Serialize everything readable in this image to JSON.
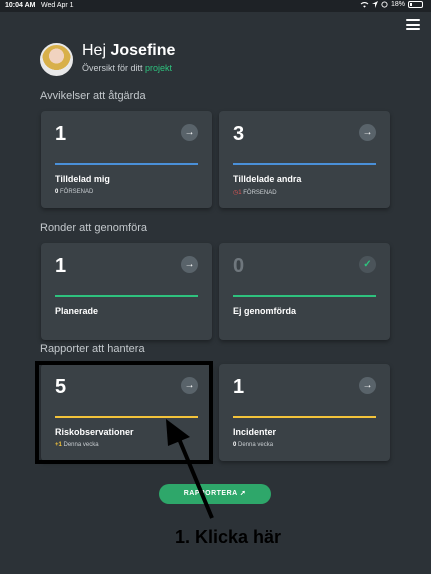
{
  "status_bar": {
    "time": "10:04 AM",
    "date": "Wed Apr 1",
    "battery": "18%",
    "battery_level": 0.18
  },
  "header": {
    "greeting_prefix": "Hej",
    "user_name": "Josefine",
    "overview_prefix": "Översikt för ditt",
    "overview_link": "projekt"
  },
  "sections": {
    "deviations": {
      "title": "Avvikelser att åtgärda",
      "cards": [
        {
          "count": "1",
          "label": "Tilldelad mig",
          "sub_count": "0",
          "sub_text": "FÖRSENAD"
        },
        {
          "count": "3",
          "label": "Tilldelade andra",
          "sub_count": "1",
          "sub_text": "FÖRSENAD"
        }
      ]
    },
    "rounds": {
      "title": "Ronder att genomföra",
      "cards": [
        {
          "count": "1",
          "label": "Planerade"
        },
        {
          "count": "0",
          "label": "Ej genomförda"
        }
      ]
    },
    "reports": {
      "title": "Rapporter att hantera",
      "cards": [
        {
          "count": "5",
          "label": "Riskobservationer",
          "sub_count": "+1",
          "sub_text": "Denna vecka"
        },
        {
          "count": "1",
          "label": "Incidenter",
          "sub_count": "0",
          "sub_text": "Denna vecka"
        }
      ]
    }
  },
  "report_button": {
    "label": "RAPPORTERA"
  },
  "instruction": "1. Klicka här",
  "icons": {
    "arrow": "arrow-right-icon",
    "check": "check-icon",
    "clock": "clock-alert-icon",
    "menu": "hamburger-menu-icon",
    "share": "share-arrow-icon"
  },
  "colors": {
    "background": "#2c3237",
    "card": "#3a4146",
    "blue": "#4a90d9",
    "green": "#2ec27e",
    "yellow": "#f3c33b",
    "alert": "#e05555",
    "button": "#2ea76a"
  }
}
